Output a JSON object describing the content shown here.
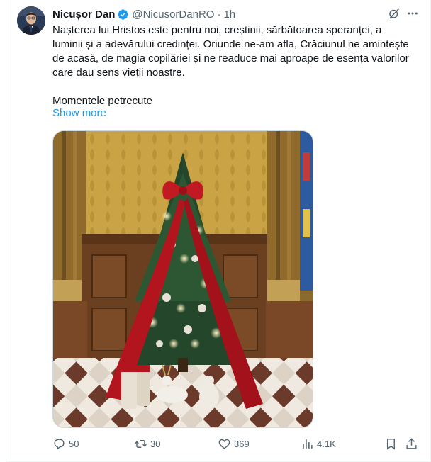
{
  "author": {
    "display_name": "Nicușor Dan",
    "handle": "@NicusorDanRO",
    "separator": "·",
    "time": "1h"
  },
  "tweet": {
    "paragraph_1": "Nașterea lui Hristos este pentru noi, creștinii, sărbătoarea speranței, a luminii și a adevărului credinței. Oriunde ne-am afla, Crăciunul ne amintește de acasă, de magia copilăriei și ne readuce mai aproape de esența valorilor care dau sens vieții noastre.",
    "paragraph_2": "Momentele petrecute",
    "show_more": "Show more"
  },
  "actions": {
    "replies": "50",
    "reposts": "30",
    "likes": "369",
    "views": "4.1K"
  },
  "colors": {
    "link": "#1d9bf0",
    "verified": "#1d9bf0",
    "muted": "#536471",
    "ribbon": "#b3151e"
  },
  "icons": [
    "verified-badge-icon",
    "grok-icon",
    "more-icon",
    "reply-icon",
    "repost-icon",
    "like-icon",
    "views-icon",
    "bookmark-icon",
    "share-icon"
  ]
}
